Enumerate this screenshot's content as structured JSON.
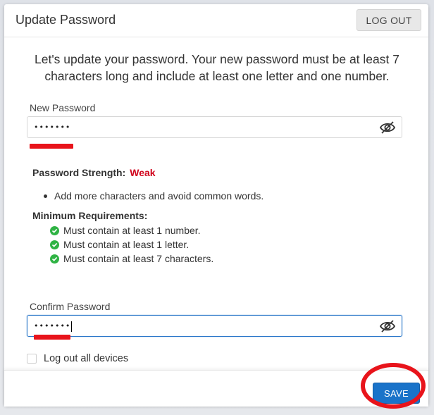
{
  "header": {
    "title": "Update Password",
    "logout_label": "LOG OUT"
  },
  "intro": "Let's update your password. Your new password must be at least 7 characters long and include at least one letter and one number.",
  "new_password": {
    "label": "New Password",
    "value": "•••••••",
    "toggle_icon": "eye-slash-icon"
  },
  "strength": {
    "label": "Password Strength:",
    "value": "Weak",
    "value_color": "#d0021b"
  },
  "suggestions": [
    "Add more characters and avoid common words."
  ],
  "requirements": {
    "heading": "Minimum Requirements:",
    "items": [
      "Must contain at least 1 number.",
      "Must contain at least 1 letter.",
      "Must contain at least 7 characters."
    ],
    "check_color": "#2fb344"
  },
  "confirm_password": {
    "label": "Confirm Password",
    "value": "•••••••",
    "toggle_icon": "eye-slash-icon"
  },
  "logout_devices": {
    "label": "Log out all devices",
    "checked": false
  },
  "footer": {
    "save_label": "SAVE"
  },
  "colors": {
    "accent": "#1a73c9",
    "annotation": "#e8141b"
  }
}
